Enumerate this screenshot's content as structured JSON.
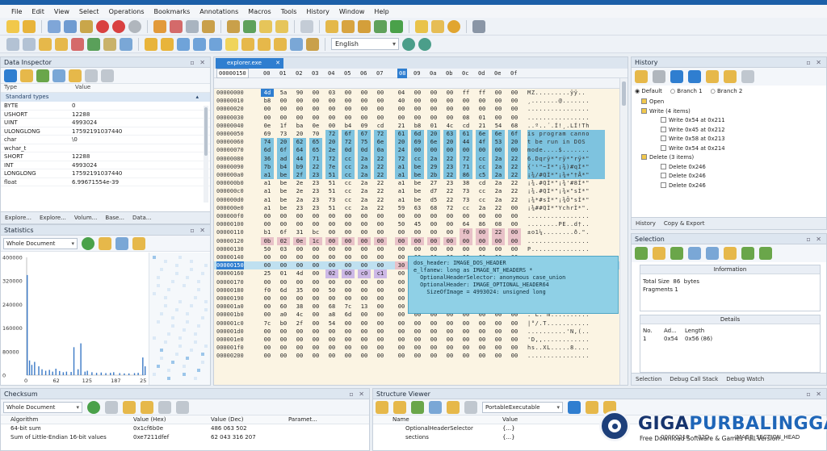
{
  "menu": [
    "File",
    "Edit",
    "View",
    "Select",
    "Operations",
    "Bookmarks",
    "Annotations",
    "Macros",
    "Tools",
    "History",
    "Window",
    "Help"
  ],
  "toolbar": {
    "language": "English"
  },
  "data_inspector": {
    "title": "Data Inspector",
    "col_type": "Type",
    "col_value": "Value",
    "group": "Standard types",
    "rows": [
      {
        "type": "BYTE",
        "value": "0"
      },
      {
        "type": "USHORT",
        "value": "12288"
      },
      {
        "type": "UINT",
        "value": "4993024"
      },
      {
        "type": "ULONGLONG",
        "value": "17592191037440"
      },
      {
        "type": "char",
        "value": "\\0"
      },
      {
        "type": "wchar_t",
        "value": ""
      },
      {
        "type": "SHORT",
        "value": "12288"
      },
      {
        "type": "INT",
        "value": "4993024"
      },
      {
        "type": "LONGLONG",
        "value": "17592191037440"
      },
      {
        "type": "float",
        "value": "6.99671554e-39"
      }
    ],
    "tabs": [
      "Explore...",
      "Explore...",
      "Volum...",
      "Base...",
      "Data..."
    ]
  },
  "statistics": {
    "title": "Statistics",
    "scope": "Whole Document",
    "y_ticks": [
      "400000",
      "320000",
      "240000",
      "160000",
      "80000",
      "0"
    ],
    "x_ticks": [
      "0",
      "62",
      "125",
      "187",
      "250"
    ]
  },
  "chart_data": {
    "type": "bar",
    "title": "",
    "xlabel": "",
    "ylabel": "",
    "ylim": [
      0,
      400000
    ],
    "xlim": [
      0,
      255
    ],
    "x": [
      0,
      5,
      10,
      16,
      25,
      32,
      40,
      48,
      55,
      62,
      70,
      78,
      85,
      95,
      101,
      110,
      116,
      125,
      130,
      140,
      150,
      160,
      170,
      180,
      187,
      200,
      210,
      220,
      232,
      240,
      250,
      255
    ],
    "values": [
      340000,
      50000,
      35000,
      45000,
      30000,
      20000,
      15000,
      18000,
      12000,
      22000,
      14000,
      10000,
      12000,
      11000,
      95000,
      20000,
      108000,
      12000,
      15000,
      10000,
      8000,
      9000,
      7000,
      8000,
      10000,
      7000,
      6000,
      6000,
      7000,
      8000,
      60000,
      30000
    ]
  },
  "hex": {
    "tab_label": "explorer.exe",
    "header_addr": "00000150",
    "columns": [
      "00",
      "01",
      "02",
      "03",
      "04",
      "05",
      "06",
      "07",
      "08",
      "09",
      "0a",
      "0b",
      "0c",
      "0d",
      "0e",
      "0f"
    ],
    "rows": [
      {
        "addr": "00000000",
        "bytes": [
          "4d",
          "5a",
          "90",
          "00",
          "03",
          "00",
          "00",
          "00",
          "04",
          "00",
          "00",
          "00",
          "ff",
          "ff",
          "00",
          "00"
        ],
        "ascii": "MZ.........ÿÿ.."
      },
      {
        "addr": "00000010",
        "bytes": [
          "b8",
          "00",
          "00",
          "00",
          "00",
          "00",
          "00",
          "00",
          "40",
          "00",
          "00",
          "00",
          "00",
          "00",
          "00",
          "00"
        ],
        "ascii": "¸.......@......."
      },
      {
        "addr": "00000020",
        "bytes": [
          "00",
          "00",
          "00",
          "00",
          "00",
          "00",
          "00",
          "00",
          "00",
          "00",
          "00",
          "00",
          "00",
          "00",
          "00",
          "00"
        ],
        "ascii": "................"
      },
      {
        "addr": "00000030",
        "bytes": [
          "00",
          "00",
          "00",
          "00",
          "00",
          "00",
          "00",
          "00",
          "00",
          "00",
          "00",
          "00",
          "08",
          "01",
          "00",
          "00"
        ],
        "ascii": "................"
      },
      {
        "addr": "00000040",
        "bytes": [
          "0e",
          "1f",
          "ba",
          "0e",
          "00",
          "b4",
          "09",
          "cd",
          "21",
          "b8",
          "01",
          "4c",
          "cd",
          "21",
          "54",
          "68"
        ],
        "ascii": "..º..´.Í!¸.LÍ!Th"
      },
      {
        "addr": "00000050",
        "bytes": [
          "69",
          "73",
          "20",
          "70",
          "72",
          "6f",
          "67",
          "72",
          "61",
          "6d",
          "20",
          "63",
          "61",
          "6e",
          "6e",
          "6f"
        ],
        "ascii": "is program canno"
      },
      {
        "addr": "00000060",
        "bytes": [
          "74",
          "20",
          "62",
          "65",
          "20",
          "72",
          "75",
          "6e",
          "20",
          "69",
          "6e",
          "20",
          "44",
          "4f",
          "53",
          "20"
        ],
        "ascii": "t be run in DOS "
      },
      {
        "addr": "00000070",
        "bytes": [
          "6d",
          "6f",
          "64",
          "65",
          "2e",
          "0d",
          "0d",
          "0a",
          "24",
          "00",
          "00",
          "00",
          "00",
          "00",
          "00",
          "00"
        ],
        "ascii": "mode....$......."
      },
      {
        "addr": "00000080",
        "bytes": [
          "36",
          "ad",
          "44",
          "71",
          "72",
          "cc",
          "2a",
          "22",
          "72",
          "cc",
          "2a",
          "22",
          "72",
          "cc",
          "2a",
          "22"
        ],
        "ascii": "6.Dqrÿ*\"rÿ*\"rÿ*\""
      },
      {
        "addr": "00000090",
        "bytes": [
          "7b",
          "b4",
          "b9",
          "22",
          "7e",
          "cc",
          "2a",
          "22",
          "a1",
          "be",
          "29",
          "23",
          "71",
          "cc",
          "2a",
          "22"
        ],
        "ascii": "{'¹\"~Ì*\"¡¾)#qÌ*\""
      },
      {
        "addr": "000000a0",
        "bytes": [
          "a1",
          "be",
          "2f",
          "23",
          "51",
          "cc",
          "2a",
          "22",
          "a1",
          "be",
          "2b",
          "22",
          "86",
          "c5",
          "2a",
          "22"
        ],
        "ascii": "¡¾/#QÌ*\"¡¾+\"†Å*\""
      },
      {
        "addr": "000000b0",
        "bytes": [
          "a1",
          "be",
          "2e",
          "23",
          "51",
          "cc",
          "2a",
          "22",
          "a1",
          "be",
          "27",
          "23",
          "38",
          "cd",
          "2a",
          "22"
        ],
        "ascii": "¡¾.#QÌ*\"¡¾'#8Í*\""
      },
      {
        "addr": "000000c0",
        "bytes": [
          "a1",
          "be",
          "2e",
          "23",
          "51",
          "cc",
          "2a",
          "22",
          "a1",
          "be",
          "d7",
          "22",
          "73",
          "cc",
          "2a",
          "22"
        ],
        "ascii": "¡¾.#QÌ*\"¡¾×\"sÌ*\""
      },
      {
        "addr": "000000d0",
        "bytes": [
          "a1",
          "be",
          "2a",
          "23",
          "73",
          "cc",
          "2a",
          "22",
          "a1",
          "be",
          "d5",
          "22",
          "73",
          "cc",
          "2a",
          "22"
        ],
        "ascii": "¡¾*#sÌ*\"¡¾Õ\"sÌ*\""
      },
      {
        "addr": "000000e0",
        "bytes": [
          "a1",
          "be",
          "23",
          "23",
          "51",
          "cc",
          "2a",
          "22",
          "59",
          "63",
          "68",
          "72",
          "cc",
          "2a",
          "22",
          "00"
        ],
        "ascii": "¡¾##QÌ*\"YchrÌ*\"."
      },
      {
        "addr": "000000f0",
        "bytes": [
          "00",
          "00",
          "00",
          "00",
          "00",
          "00",
          "00",
          "00",
          "00",
          "00",
          "00",
          "00",
          "00",
          "00",
          "00",
          "00"
        ],
        "ascii": "................"
      },
      {
        "addr": "00000100",
        "bytes": [
          "00",
          "00",
          "00",
          "00",
          "00",
          "00",
          "00",
          "00",
          "50",
          "45",
          "00",
          "00",
          "64",
          "86",
          "08",
          "00"
        ],
        "ascii": "........PE..d†.."
      },
      {
        "addr": "00000110",
        "bytes": [
          "b1",
          "6f",
          "31",
          "bc",
          "00",
          "00",
          "00",
          "00",
          "00",
          "00",
          "00",
          "00",
          "f0",
          "00",
          "22",
          "00"
        ],
        "ascii": "±o1¼........ð.\"."
      },
      {
        "addr": "00000120",
        "bytes": [
          "0b",
          "02",
          "0e",
          "1c",
          "00",
          "00",
          "00",
          "00",
          "00",
          "00",
          "00",
          "00",
          "00",
          "00",
          "00",
          "00"
        ],
        "ascii": "................"
      },
      {
        "addr": "00000130",
        "bytes": [
          "50",
          "03",
          "00",
          "00",
          "00",
          "00",
          "00",
          "00",
          "00",
          "00",
          "00",
          "00",
          "00",
          "00",
          "00",
          "00"
        ],
        "ascii": "P..............."
      },
      {
        "addr": "00000140",
        "bytes": [
          "00",
          "00",
          "00",
          "00",
          "00",
          "00",
          "00",
          "00",
          "00",
          "00",
          "00",
          "00",
          "00",
          "00",
          "00",
          "00"
        ],
        "ascii": "................"
      },
      {
        "addr": "00000150",
        "bytes": [
          "00",
          "00",
          "00",
          "00",
          "00",
          "00",
          "00",
          "00",
          "30",
          "4c",
          "00",
          "00",
          "00",
          "00",
          "00",
          "00"
        ],
        "ascii": "........0L......"
      },
      {
        "addr": "00000160",
        "bytes": [
          "25",
          "01",
          "4d",
          "00",
          "02",
          "00",
          "c0",
          "c1",
          "00",
          "00",
          "00",
          "00",
          "00",
          "00",
          "00",
          "00"
        ],
        "ascii": "%.M...ÀÁ........"
      },
      {
        "addr": "00000170",
        "bytes": [
          "00",
          "00",
          "00",
          "00",
          "00",
          "00",
          "00",
          "00",
          "00",
          "00",
          "00",
          "00",
          "00",
          "00",
          "00",
          "00"
        ],
        "ascii": "................"
      },
      {
        "addr": "00000180",
        "bytes": [
          "f0",
          "6d",
          "35",
          "00",
          "50",
          "00",
          "00",
          "00",
          "00",
          "00",
          "00",
          "00",
          "00",
          "00",
          "00",
          "00"
        ],
        "ascii": "ðm5.P..........."
      },
      {
        "addr": "00000190",
        "bytes": [
          "00",
          "00",
          "00",
          "00",
          "00",
          "00",
          "00",
          "00",
          "00",
          "00",
          "00",
          "00",
          "00",
          "00",
          "00",
          "00"
        ],
        "ascii": "................"
      },
      {
        "addr": "000001a0",
        "bytes": [
          "00",
          "60",
          "38",
          "00",
          "68",
          "7c",
          "13",
          "00",
          "00",
          "00",
          "00",
          "00",
          "00",
          "00",
          "00",
          "00"
        ],
        "ascii": ".`8.h|.........."
      },
      {
        "addr": "000001b0",
        "bytes": [
          "00",
          "a0",
          "4c",
          "00",
          "a8",
          "6d",
          "00",
          "00",
          "00",
          "00",
          "00",
          "00",
          "00",
          "00",
          "00",
          "00"
        ],
        "ascii": ". L.¨m.........."
      },
      {
        "addr": "000001c0",
        "bytes": [
          "7c",
          "b0",
          "2f",
          "00",
          "54",
          "00",
          "00",
          "00",
          "00",
          "00",
          "00",
          "00",
          "00",
          "00",
          "00",
          "00"
        ],
        "ascii": "|°/.T..........."
      },
      {
        "addr": "000001d0",
        "bytes": [
          "00",
          "00",
          "00",
          "00",
          "00",
          "00",
          "00",
          "00",
          "00",
          "00",
          "00",
          "00",
          "00",
          "00",
          "00",
          "00"
        ],
        "ascii": "..........'N,(.."
      },
      {
        "addr": "000001e0",
        "bytes": [
          "00",
          "00",
          "00",
          "00",
          "00",
          "00",
          "00",
          "00",
          "00",
          "00",
          "00",
          "00",
          "00",
          "00",
          "00",
          "00"
        ],
        "ascii": "'D,,............"
      },
      {
        "addr": "000001f0",
        "bytes": [
          "00",
          "00",
          "00",
          "00",
          "00",
          "00",
          "00",
          "00",
          "00",
          "00",
          "00",
          "00",
          "00",
          "00",
          "00",
          "00"
        ],
        "ascii": "hs..XL.....8...."
      },
      {
        "addr": "00000200",
        "bytes": [
          "00",
          "00",
          "00",
          "00",
          "00",
          "00",
          "00",
          "00",
          "00",
          "00",
          "00",
          "00",
          "00",
          "00",
          "00",
          "00"
        ],
        "ascii": "................"
      }
    ],
    "tooltip": [
      "dos_header: IMAGE_DOS_HEADER",
      "e_lfanew: long as IMAGE_NT_HEADERS *",
      "  OptionalHeaderSelector: anonymous case_union",
      "  OptionalHeader: IMAGE_OPTIONAL_HEADER64",
      "    SizeOfImage = 4993024: unsigned long"
    ]
  },
  "history": {
    "title": "History",
    "radio": [
      "Default",
      "Branch 1",
      "Branch 2"
    ],
    "items": [
      {
        "label": "Open",
        "indent": 1
      },
      {
        "label": "Write (4 items)",
        "indent": 1
      },
      {
        "label": "Write 0x54 at 0x211",
        "indent": 2
      },
      {
        "label": "Write 0x45 at 0x212",
        "indent": 2
      },
      {
        "label": "Write 0x58 at 0x213",
        "indent": 2
      },
      {
        "label": "Write 0x54 at 0x214",
        "indent": 2
      },
      {
        "label": "Delete (3 items)",
        "indent": 1
      },
      {
        "label": "Delete 0x246",
        "indent": 2
      },
      {
        "label": "Delete 0x246",
        "indent": 2
      },
      {
        "label": "Delete 0x246",
        "indent": 2
      }
    ],
    "tabs": [
      "History",
      "Copy & Export"
    ]
  },
  "selection": {
    "title": "Selection",
    "info_header": "Information",
    "total_size_label": "Total Size",
    "total_size_value": "86",
    "total_size_unit": "bytes",
    "fragments_label": "Fragments",
    "fragments_value": "1",
    "details_header": "Details",
    "details_cols": [
      "No.",
      "Ad...",
      "Length"
    ],
    "details_row": [
      "1",
      "0x54",
      "0x56 (86)"
    ],
    "tabs": [
      "Selection",
      "Debug Call Stack",
      "Debug Watch"
    ]
  },
  "checksum": {
    "title": "Checksum",
    "scope": "Whole Document",
    "cols": [
      "Algorithm",
      "Value (Hex)",
      "Value (Dec)",
      "Paramet..."
    ],
    "rows": [
      [
        "64-bit sum",
        "0x1cf6b0e",
        "486 063 502",
        ""
      ],
      [
        "Sum of Little-Endian 16-bit values",
        "0xe7211dfef",
        "62 043 316 207",
        ""
      ]
    ]
  },
  "structure": {
    "title": "Structure Viewer",
    "combo": "PortableExecutable",
    "cols": [
      "Name",
      "Value"
    ],
    "rows": [
      [
        "OptionalHeaderSelector",
        "{...}"
      ],
      [
        "sections",
        "{...}"
      ]
    ],
    "right_row": [
      "00000210",
      "32D",
      "IMAGE_SECTION_HEAD"
    ]
  },
  "watermark": {
    "brand_a": "GIGA",
    "brand_b": "PURBALINGGA",
    "tagline": "Free Download Software & Games Full Version"
  },
  "colors": {
    "accent": "#2f7ed0",
    "selection": "#7ec3df",
    "highlight": "#f7e9c3",
    "struct_pink": "#e8c1c8",
    "struct_purple": "#cdb8e6"
  }
}
